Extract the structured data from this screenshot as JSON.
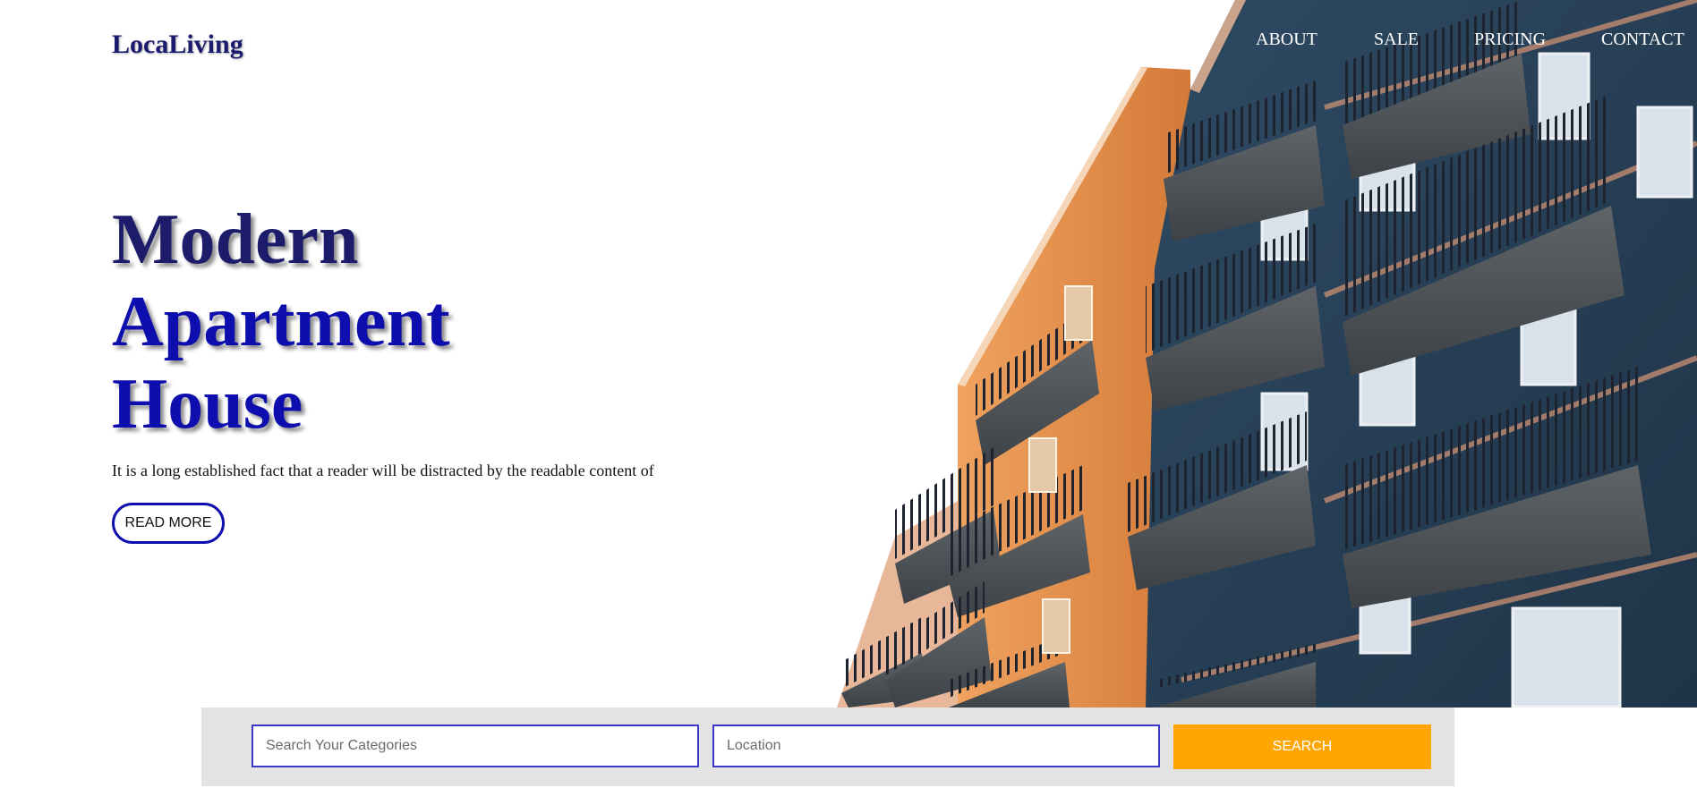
{
  "brand": {
    "logo": "LocaLiving"
  },
  "nav": {
    "items": [
      "ABOUT",
      "SALE",
      "PRICING",
      "CONTACT"
    ]
  },
  "hero": {
    "headline": [
      "Modern",
      "Apartment",
      "House"
    ],
    "tagline": "It is a long established fact that a reader will be distracted by the readable content of",
    "cta_label": "READ MORE",
    "image": "apartment-building-photo"
  },
  "search": {
    "category_placeholder": "Search Your Categories",
    "location_placeholder": "Location",
    "button_label": "SEARCH"
  },
  "colors": {
    "brand_navy": "#1c1c6b",
    "brand_blue": "#0d0ead",
    "search_button": "#ffa500",
    "search_bar_bg": "#e3e3e3",
    "input_border": "#3b38c8"
  }
}
